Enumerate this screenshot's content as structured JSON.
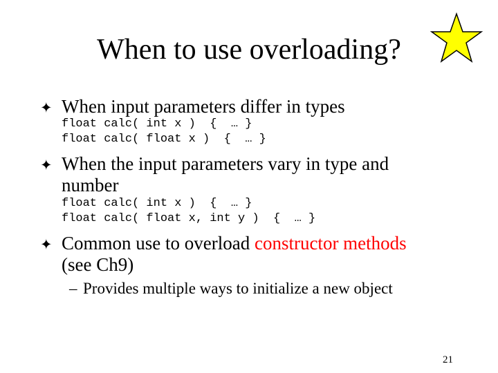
{
  "slide": {
    "title": "When to use overloading?",
    "bullets": [
      {
        "marker": "✦",
        "text": "When input parameters differ in types",
        "code": [
          "float calc( int x )  {  … }",
          "float calc( float x )  {  … }"
        ]
      },
      {
        "marker": "✦",
        "text_line1": "When the input parameters vary in type and",
        "text_line2": "number",
        "code": [
          "float calc( int x )  {  … }",
          "float calc( float x, int y )  {  … }"
        ]
      },
      {
        "marker": "✦",
        "text_prefix": "Common use to overload ",
        "text_highlight": "constructor methods",
        "text_line2": "(see Ch9)"
      }
    ],
    "subbullet": {
      "marker": "–",
      "text": "Provides multiple ways to initialize a new object"
    },
    "page_number": "21",
    "colors": {
      "highlight": "#ff0000",
      "star_fill": "#ffff00",
      "star_stroke": "#000000"
    },
    "icons": {
      "star": "star-icon",
      "bullet": "four-point-star-bullet-icon"
    }
  }
}
